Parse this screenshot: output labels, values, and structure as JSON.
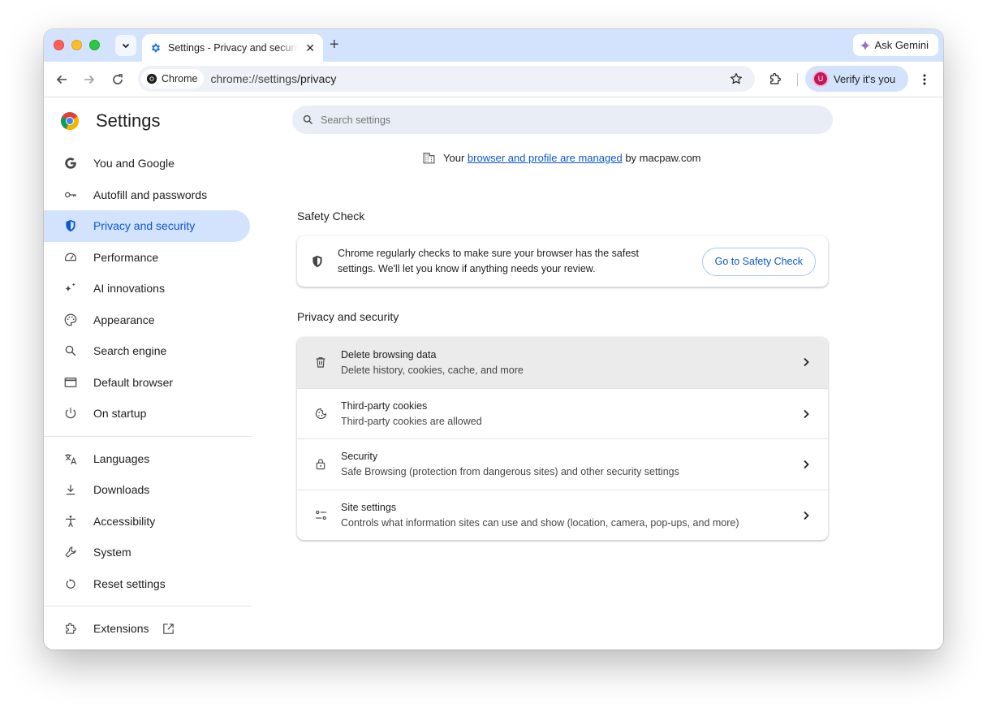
{
  "tab": {
    "title": "Settings - Privacy and security",
    "close": "✕"
  },
  "new_tab": "+",
  "ask_gemini": "Ask Gemini",
  "omnibox": {
    "chip": "Chrome",
    "url_host": "chrome://settings",
    "url_path": "/privacy"
  },
  "profile": {
    "initial": "U",
    "label": "Verify it's you"
  },
  "sidebar": {
    "title": "Settings",
    "items": [
      {
        "label": "You and Google",
        "icon": "google-g-icon"
      },
      {
        "label": "Autofill and passwords",
        "icon": "key-icon"
      },
      {
        "label": "Privacy and security",
        "icon": "shield-icon",
        "active": true
      },
      {
        "label": "Performance",
        "icon": "speedometer-icon"
      },
      {
        "label": "AI innovations",
        "icon": "sparkle-icon"
      },
      {
        "label": "Appearance",
        "icon": "palette-icon"
      },
      {
        "label": "Search engine",
        "icon": "search-icon"
      },
      {
        "label": "Default browser",
        "icon": "browser-window-icon"
      },
      {
        "label": "On startup",
        "icon": "power-icon"
      },
      {
        "label": "Languages",
        "icon": "translate-icon"
      },
      {
        "label": "Downloads",
        "icon": "download-icon"
      },
      {
        "label": "Accessibility",
        "icon": "accessibility-icon"
      },
      {
        "label": "System",
        "icon": "wrench-icon"
      },
      {
        "label": "Reset settings",
        "icon": "reset-icon"
      },
      {
        "label": "Extensions",
        "icon": "puzzle-icon"
      }
    ]
  },
  "search": {
    "placeholder": "Search settings"
  },
  "managed": {
    "prefix": "Your",
    "link": "browser and profile are managed",
    "suffix": "by macpaw.com"
  },
  "safety_check": {
    "title": "Safety Check",
    "description": "Chrome regularly checks to make sure your browser has the safest settings. We'll let you know if anything needs your review.",
    "button": "Go to Safety Check"
  },
  "privacy": {
    "title": "Privacy and security",
    "rows": [
      {
        "title": "Delete browsing data",
        "subtitle": "Delete history, cookies, cache, and more",
        "icon": "trash-icon"
      },
      {
        "title": "Third-party cookies",
        "subtitle": "Third-party cookies are allowed",
        "icon": "cookie-icon"
      },
      {
        "title": "Security",
        "subtitle": "Safe Browsing (protection from dangerous sites) and other security settings",
        "icon": "lock-icon"
      },
      {
        "title": "Site settings",
        "subtitle": "Controls what information sites can use and show (location, camera, pop-ups, and more)",
        "icon": "sliders-icon"
      }
    ]
  },
  "colors": {
    "accent": "#0b57d0",
    "tabstrip": "#d3e3fd",
    "active_nav": "#d3e3fd"
  }
}
